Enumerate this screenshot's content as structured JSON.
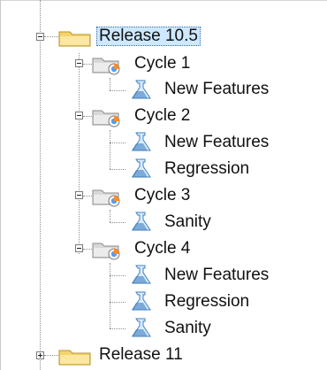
{
  "tree": {
    "release_1": {
      "label": "Release 10.5",
      "expanded": true,
      "selected": true,
      "icon": "folder-icon"
    },
    "cycle_1": {
      "label": "Cycle 1",
      "expanded": true,
      "icon": "test-cycle-folder-icon"
    },
    "cycle_1_test_1": {
      "label": "New Features",
      "icon": "test-set-flask-icon"
    },
    "cycle_2": {
      "label": "Cycle 2",
      "expanded": true,
      "icon": "test-cycle-folder-icon"
    },
    "cycle_2_test_1": {
      "label": "New Features",
      "icon": "test-set-flask-icon"
    },
    "cycle_2_test_2": {
      "label": "Regression",
      "icon": "test-set-flask-icon"
    },
    "cycle_3": {
      "label": "Cycle 3",
      "expanded": true,
      "icon": "test-cycle-folder-icon"
    },
    "cycle_3_test_1": {
      "label": "Sanity",
      "icon": "test-set-flask-icon"
    },
    "cycle_4": {
      "label": "Cycle 4",
      "expanded": true,
      "icon": "test-cycle-folder-icon"
    },
    "cycle_4_test_1": {
      "label": "New Features",
      "icon": "test-set-flask-icon"
    },
    "cycle_4_test_2": {
      "label": "Regression",
      "icon": "test-set-flask-icon"
    },
    "cycle_4_test_3": {
      "label": "Sanity",
      "icon": "test-set-flask-icon"
    },
    "release_2": {
      "label": "Release 11",
      "expanded": false,
      "icon": "folder-icon"
    }
  },
  "colors": {
    "selection": "#cde8ff",
    "folder": "#f3d46a",
    "flask": "#3f7fc0"
  }
}
